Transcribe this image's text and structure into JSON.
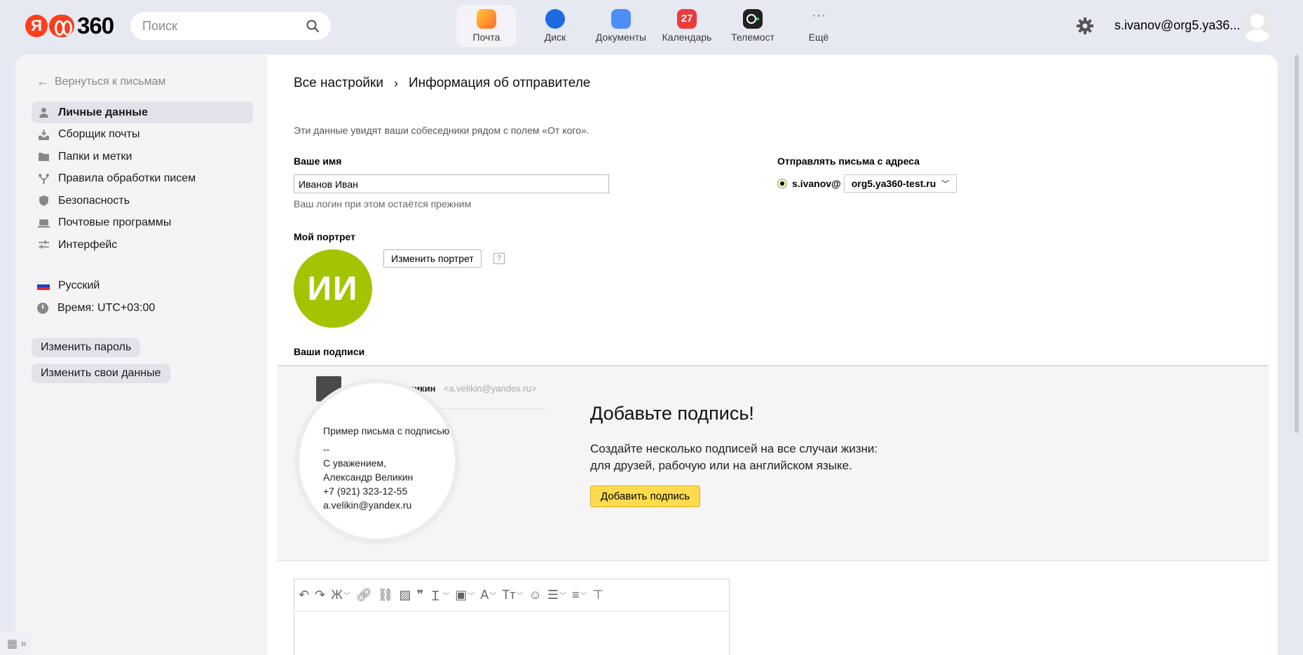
{
  "header": {
    "logo_text": "360",
    "logo_letter": "Я",
    "search_placeholder": "Поиск",
    "apps": [
      {
        "label": "Почта"
      },
      {
        "label": "Диск"
      },
      {
        "label": "Документы"
      },
      {
        "label": "Календарь",
        "badge": "27"
      },
      {
        "label": "Телемост"
      },
      {
        "label": "Ещё"
      }
    ],
    "user_email": "s.ivanov@org5.ya36..."
  },
  "sidebar": {
    "back_label": "Вернуться к письмам",
    "items": [
      {
        "label": "Личные данные",
        "icon": "person-icon"
      },
      {
        "label": "Сборщик почты",
        "icon": "inbox-download-icon"
      },
      {
        "label": "Папки и метки",
        "icon": "folder-icon"
      },
      {
        "label": "Правила обработки писем",
        "icon": "rules-icon"
      },
      {
        "label": "Безопасность",
        "icon": "shield-icon"
      },
      {
        "label": "Почтовые программы",
        "icon": "laptop-icon"
      },
      {
        "label": "Интерфейс",
        "icon": "sliders-icon"
      }
    ],
    "language": "Русский",
    "time": "Время: UTC+03:00",
    "change_password": "Изменить пароль",
    "change_data": "Изменить свои данные"
  },
  "main": {
    "breadcrumb_root": "Все настройки",
    "breadcrumb_separator": "›",
    "breadcrumb_current": "Информация об отправителе",
    "description": "Эти данные увидят ваши собеседники рядом с полем «От кого».",
    "name_label": "Ваше имя",
    "name_value": "Иванов Иван",
    "name_hint": "Ваш логин при этом остаётся прежним",
    "from_label": "Отправлять письма с адреса",
    "from_login": "s.ivanov@",
    "from_domain": "org5.ya360-test.ru",
    "portrait_label": "Мой портрет",
    "portrait_initials": "ИИ",
    "portrait_button": "Изменить портрет",
    "portrait_help": "?",
    "signatures_label": "Ваши подписи",
    "example": {
      "name": "Александр Великин",
      "email": "<a.velikin@yandex.ru>",
      "subject": "Пример письма с подписью",
      "dashes": "--",
      "regards": "С уважением,",
      "sign_name": "Александр Великин",
      "phone": "+7 (921) 323-12-55",
      "sign_email": "a.velikin@yandex.ru"
    },
    "add_title": "Добавьте подпись!",
    "add_text_1": "Создайте несколько подписей на все случаи жизни:",
    "add_text_2": "для друзей, рабочую или на английском языке.",
    "add_button": "Добавить подпись"
  },
  "colors": {
    "accent_yellow": "#ffdb4d",
    "portrait_green": "#a3c400",
    "brand_red": "#fc3f1d"
  }
}
